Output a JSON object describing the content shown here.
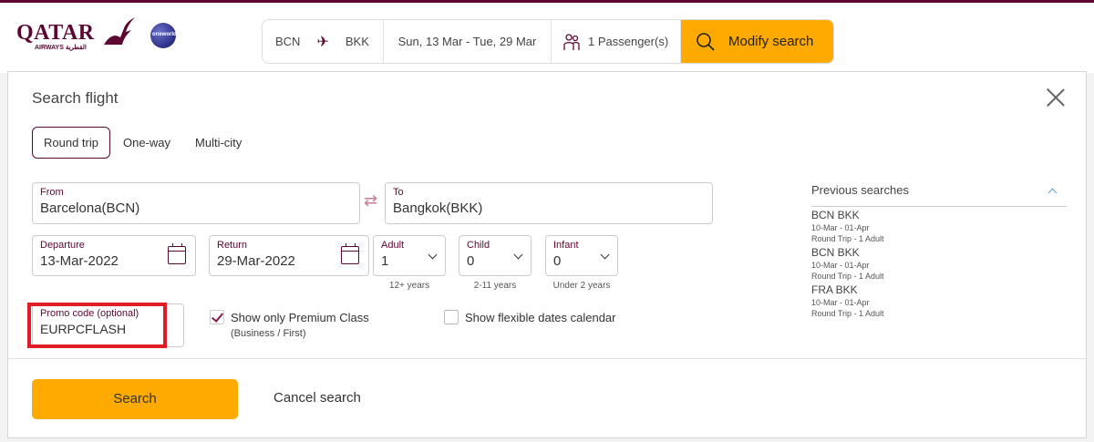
{
  "header": {
    "logo_text": "QATAR",
    "logo_sub": "AIRWAYS القطرية",
    "alliance_badge": "oneworld",
    "summary": {
      "origin": "BCN",
      "destination": "BKK",
      "dates": "Sun, 13 Mar - Tue, 29 Mar",
      "passengers": "1 Passenger(s)",
      "modify_label": "Modify search"
    }
  },
  "modal": {
    "title": "Search flight",
    "trip_tabs": [
      "Round trip",
      "One-way",
      "Multi-city"
    ],
    "from": {
      "label": "From",
      "value": "Barcelona(BCN)"
    },
    "to": {
      "label": "To",
      "value": "Bangkok(BKK)"
    },
    "departure": {
      "label": "Departure",
      "value": "13-Mar-2022"
    },
    "return": {
      "label": "Return",
      "value": "29-Mar-2022"
    },
    "adult": {
      "label": "Adult",
      "value": "1",
      "hint": "12+ years"
    },
    "child": {
      "label": "Child",
      "value": "0",
      "hint": "2-11 years"
    },
    "infant": {
      "label": "Infant",
      "value": "0",
      "hint": "Under 2 years"
    },
    "promo": {
      "label": "Promo code (optional)",
      "value": "EURPCFLASH"
    },
    "premium_only": {
      "label": "Show only Premium Class",
      "sub": "(Business / First)",
      "checked": true
    },
    "flexible_dates": {
      "label": "Show flexible dates calendar",
      "checked": false
    },
    "search_label": "Search",
    "cancel_label": "Cancel search"
  },
  "previous_searches": {
    "title": "Previous searches",
    "items": [
      {
        "route": "BCN BKK",
        "dates": "10-Mar - 01-Apr",
        "details": "Round Trip - 1 Adult"
      },
      {
        "route": "BCN BKK",
        "dates": "10-Mar - 01-Apr",
        "details": "Round Trip - 1 Adult"
      },
      {
        "route": "FRA BKK",
        "dates": "10-Mar - 01-Apr",
        "details": "Round Trip - 1 Adult"
      }
    ]
  },
  "colors": {
    "brand": "#5c0632",
    "accent": "#ffaa00",
    "highlight": "#e01d25"
  }
}
